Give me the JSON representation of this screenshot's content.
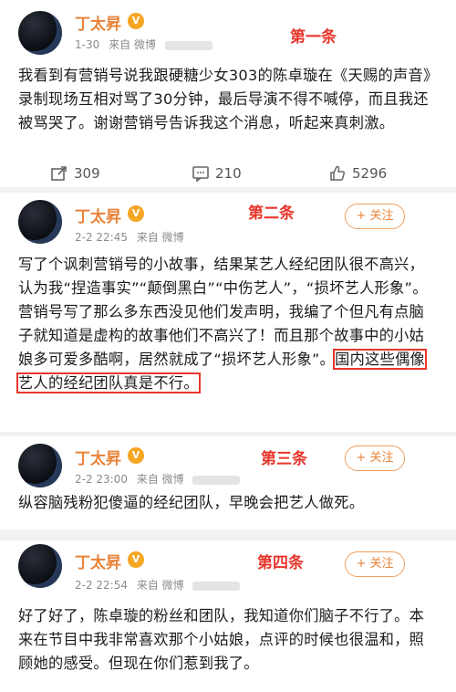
{
  "posts": [
    {
      "author": "丁太昇",
      "badge": "V",
      "meta_time": "1-30",
      "meta_source": "来自 微博",
      "tag": "第一条",
      "text": "我看到有营销号说我跟硬糖少女303的陈卓璇在《天赐的声音》录制现场互相对骂了30分钟，最后导演不得不喊停，而且我还被骂哭了。谢谢营销号告诉我这个消息，听起来真刺激。",
      "repost_count": "309",
      "comment_count": "210",
      "like_count": "5296"
    },
    {
      "author": "丁太昇",
      "badge": "V",
      "meta_time": "2-2 22:45",
      "meta_source": "来自 微博",
      "tag": "第二条",
      "follow_label": "+ 关注",
      "text_plain": "写了个讽刺营销号的小故事，结果某艺人经纪团队很不高兴，认为我“捏造事实”“颠倒黑白”“中伤艺人”，“损坏艺人形象”。营销号写了那么多东西没见他们发声明，我编了个但凡有点脑子就知道是虚构的故事他们不高兴了！而且那个故事中的小姑娘多可爱多酷啊，居然就成了“损坏艺人形象”。",
      "text_highlight": "国内这些偶像艺人的经纪团队真是不行。"
    },
    {
      "author": "丁太昇",
      "badge": "V",
      "meta_time": "2-2 23:00",
      "meta_source": "来自 微博",
      "tag": "第三条",
      "follow_label": "+ 关注",
      "text": "纵容脑残粉犯傻逼的经纪团队，早晚会把艺人做死。"
    },
    {
      "author": "丁太昇",
      "badge": "V",
      "meta_time": "2-2 22:54",
      "meta_source": "来自 微博",
      "tag": "第四条",
      "follow_label": "+ 关注",
      "text": "好了好了，陈卓璇的粉丝和团队，我知道你们脑子不行了。本来在节目中我非常喜欢那个小姑娘，点评的时候也很温和，照顾她的感受。但现在你们惹到我了。"
    }
  ],
  "icons": {
    "repost": "repost-icon",
    "comment": "comment-icon",
    "like": "like-icon"
  },
  "colors": {
    "name": "#e8833a",
    "tag": "#e8352b",
    "highlight_border": "#e8352b"
  }
}
